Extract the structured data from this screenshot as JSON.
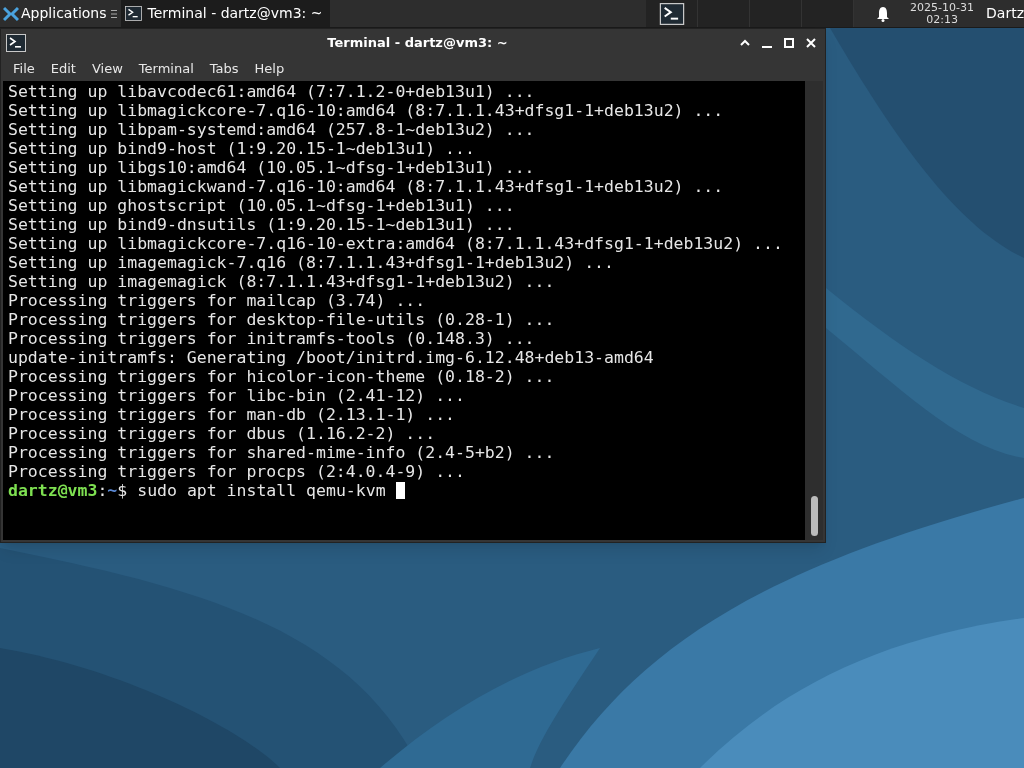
{
  "panel": {
    "applications_label": "Applications",
    "tasks": [
      {
        "title": "Terminal - dartz@vm3: ~",
        "selected": true
      }
    ],
    "workspaces": [
      {
        "has_window": true
      },
      {
        "has_window": false
      },
      {
        "has_window": false
      },
      {
        "has_window": false
      }
    ],
    "clock": {
      "date": "2025-10-31",
      "time": "02:13"
    },
    "user": "Dartz"
  },
  "window": {
    "title": "Terminal - dartz@vm3: ~",
    "menu": [
      "File",
      "Edit",
      "View",
      "Terminal",
      "Tabs",
      "Help"
    ],
    "lines": [
      "Setting up libavcodec61:amd64 (7:7.1.2-0+deb13u1) ...",
      "Setting up libmagickcore-7.q16-10:amd64 (8:7.1.1.43+dfsg1-1+deb13u2) ...",
      "Setting up libpam-systemd:amd64 (257.8-1~deb13u2) ...",
      "Setting up bind9-host (1:9.20.15-1~deb13u1) ...",
      "Setting up libgs10:amd64 (10.05.1~dfsg-1+deb13u1) ...",
      "Setting up libmagickwand-7.q16-10:amd64 (8:7.1.1.43+dfsg1-1+deb13u2) ...",
      "Setting up ghostscript (10.05.1~dfsg-1+deb13u1) ...",
      "Setting up bind9-dnsutils (1:9.20.15-1~deb13u1) ...",
      "Setting up libmagickcore-7.q16-10-extra:amd64 (8:7.1.1.43+dfsg1-1+deb13u2) ...",
      "Setting up imagemagick-7.q16 (8:7.1.1.43+dfsg1-1+deb13u2) ...",
      "Setting up imagemagick (8:7.1.1.43+dfsg1-1+deb13u2) ...",
      "Processing triggers for mailcap (3.74) ...",
      "Processing triggers for desktop-file-utils (0.28-1) ...",
      "Processing triggers for initramfs-tools (0.148.3) ...",
      "update-initramfs: Generating /boot/initrd.img-6.12.48+deb13-amd64",
      "Processing triggers for hicolor-icon-theme (0.18-2) ...",
      "Processing triggers for libc-bin (2.41-12) ...",
      "Processing triggers for man-db (2.13.1-1) ...",
      "Processing triggers for dbus (1.16.2-2) ...",
      "Processing triggers for shared-mime-info (2.4-5+b2) ...",
      "Processing triggers for procps (2:4.0.4-9) ..."
    ],
    "prompt": {
      "user_host": "dartz@vm3",
      "separator": ":",
      "path": "~",
      "symbol": "$",
      "command": "sudo apt install qemu-kvm"
    }
  }
}
